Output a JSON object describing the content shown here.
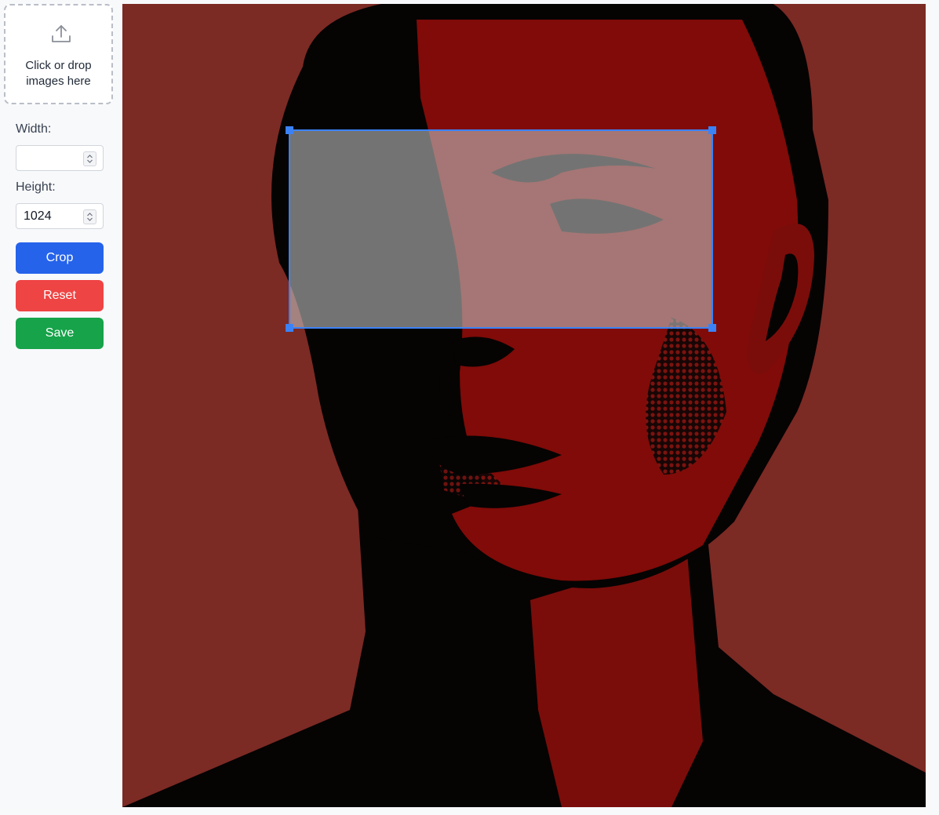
{
  "dropzone": {
    "text": "Click or drop images here",
    "icon": "upload-icon"
  },
  "width": {
    "label": "Width:",
    "value": ""
  },
  "height": {
    "label": "Height:",
    "value": "1024"
  },
  "buttons": {
    "crop": "Crop",
    "reset": "Reset",
    "save": "Save"
  },
  "colors": {
    "crop": "#2563eb",
    "reset": "#ef4444",
    "save": "#16a34a",
    "selection_border": "#3b82f6"
  }
}
